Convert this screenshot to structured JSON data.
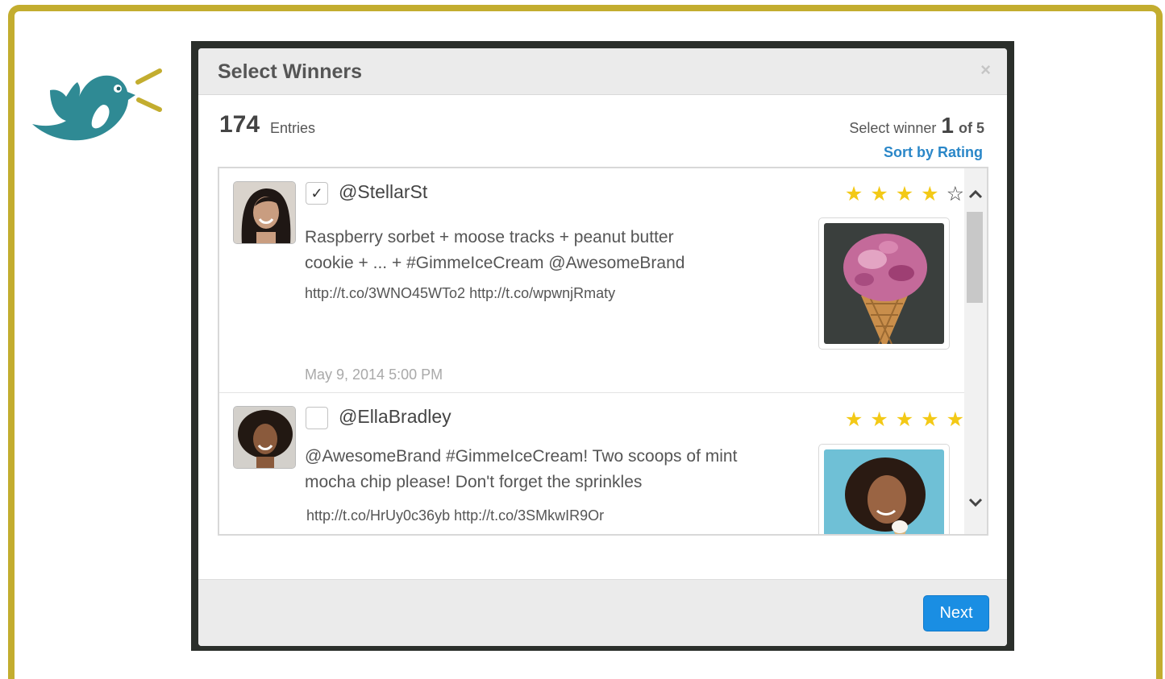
{
  "modal": {
    "title": "Select Winners",
    "close_label": "×"
  },
  "summary": {
    "entries_count": "174",
    "entries_label": "Entries",
    "select_winner_label": "Select winner",
    "current_winner": "1",
    "total_winners": "of 5",
    "sort_link": "Sort by Rating"
  },
  "entries": [
    {
      "handle": "@StellarSt",
      "checked": true,
      "check_glyph": "✓",
      "tweet_line1": "Raspberry sorbet + moose tracks + peanut butter",
      "tweet_line2": "cookie + ... + #GimmeIceCream @AwesomeBrand",
      "links": "http://t.co/3WNO45WTo2 http://t.co/wpwnjRmaty",
      "date": "May 9, 2014 5:00 PM",
      "rating": 4,
      "max_rating": 5,
      "photo": "ice-cream-cone-photo"
    },
    {
      "handle": "@EllaBradley",
      "checked": false,
      "check_glyph": "",
      "tweet_line1": "@AwesomeBrand #GimmeIceCream! Two scoops of mint",
      "tweet_line2": "mocha chip please! Don't forget the sprinkles",
      "links": "http://t.co/HrUy0c36yb http://t.co/3SMkwIR9Or",
      "rating": 5,
      "max_rating": 5,
      "photo": "woman-with-ice-cream-photo"
    }
  ],
  "footer": {
    "next_label": "Next"
  },
  "colors": {
    "frame": "#c3ad2f",
    "bird": "#2f8a94",
    "accent_link": "#2a87c8",
    "primary_button": "#1a8ee3",
    "star": "#f3c916"
  },
  "icons": {
    "brand": "bird-logo-icon",
    "star_filled": "★",
    "star_empty": "☆",
    "scroll_up": "⌃",
    "scroll_down": "⌄"
  }
}
